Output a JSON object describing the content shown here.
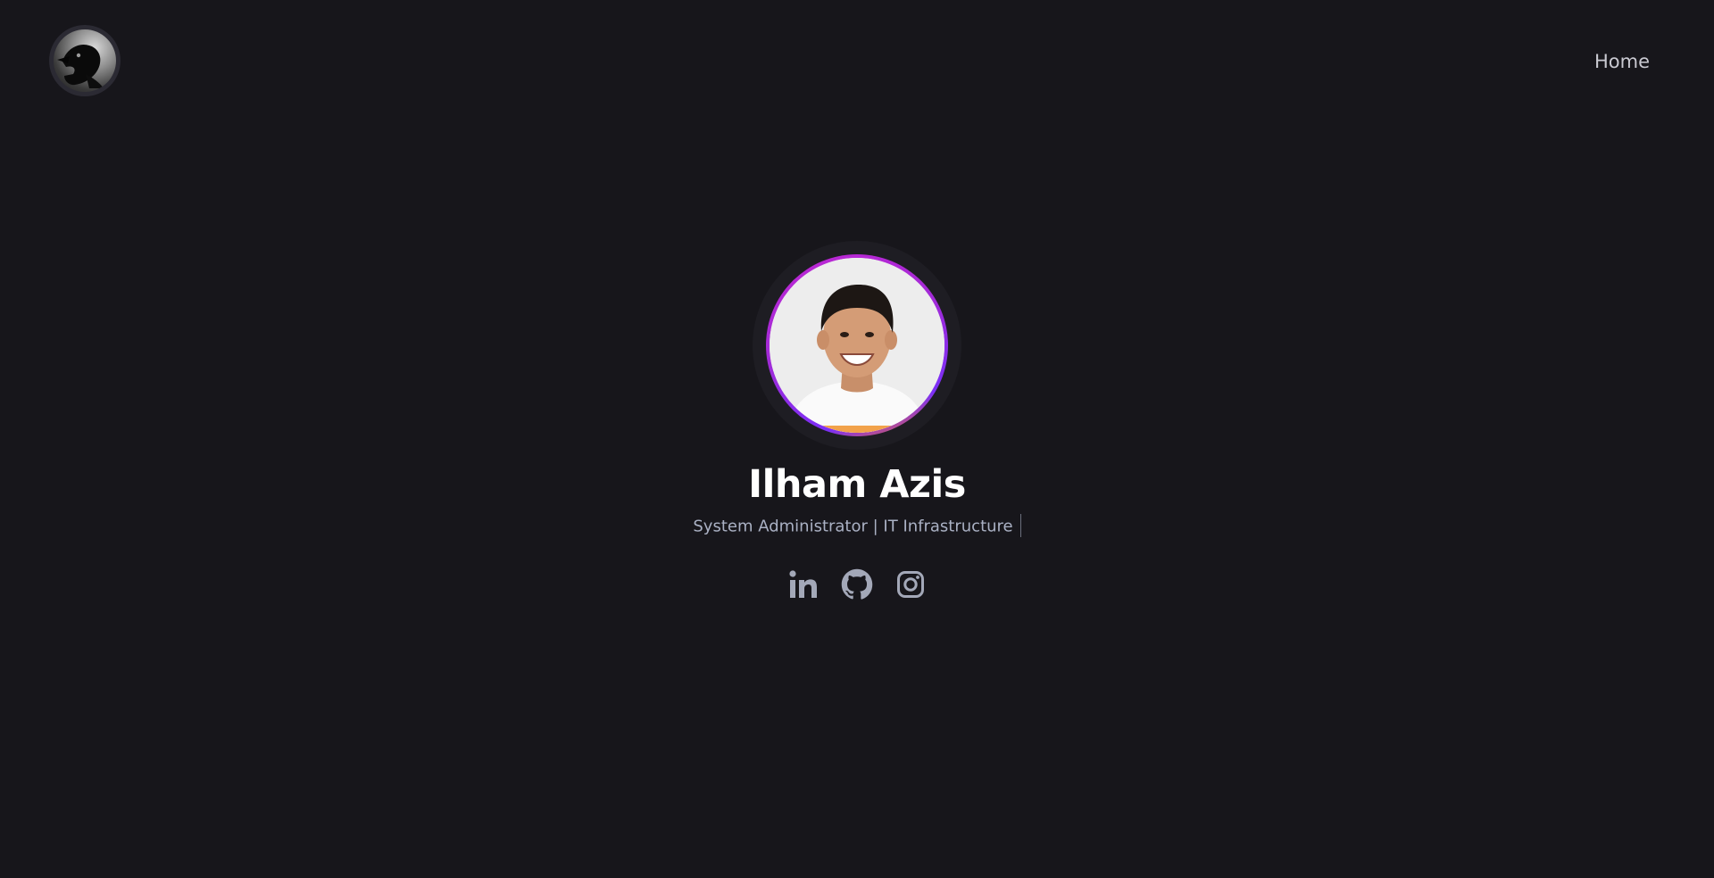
{
  "header": {
    "logo_icon": "crow-avatar-icon",
    "nav": [
      {
        "label": "Home"
      }
    ]
  },
  "hero": {
    "name": "Ilham Azis",
    "tagline": "System Administrator | IT Infrastructure",
    "socials": [
      {
        "icon": "linkedin-icon"
      },
      {
        "icon": "github-icon"
      },
      {
        "icon": "instagram-icon"
      }
    ]
  },
  "colors": {
    "background": "#17161b",
    "accent_purple": "#c026d3",
    "text_muted": "#aab1c4",
    "icon": "#a3a8b8"
  }
}
